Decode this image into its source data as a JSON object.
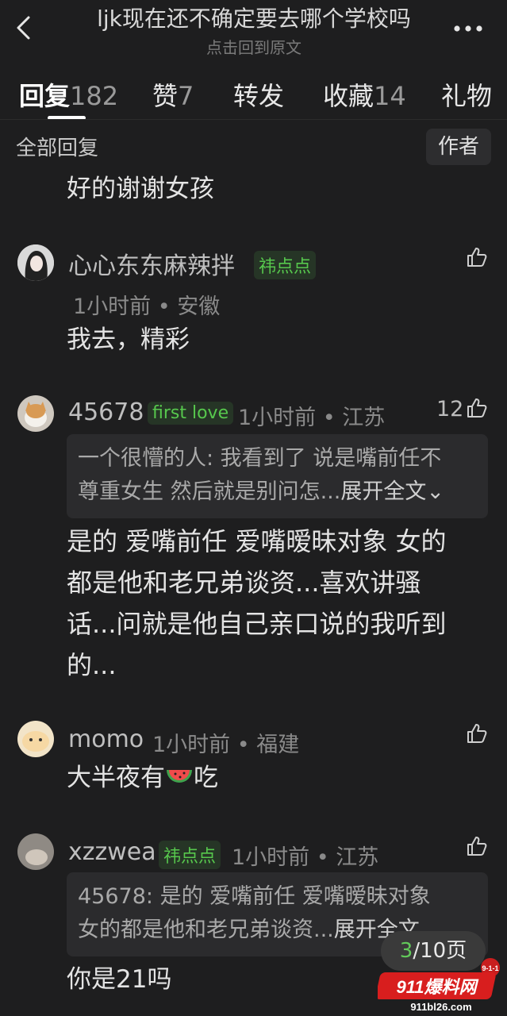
{
  "header": {
    "title": "ljk现在还不确定要去哪个学校吗",
    "subtitle": "点击回到原文"
  },
  "tabs": [
    {
      "label": "回复",
      "count": "182"
    },
    {
      "label": "赞",
      "count": "7"
    },
    {
      "label": "转发",
      "count": ""
    },
    {
      "label": "收藏",
      "count": "14"
    },
    {
      "label": "礼物",
      "count": ""
    }
  ],
  "filter": {
    "all_label": "全部回复",
    "author_label": "作者"
  },
  "top_text": "好的谢谢女孩",
  "comments": [
    {
      "username": "心心东东麻辣拌",
      "badge": "祎点点",
      "time": "1小时前",
      "location": "安徽",
      "text": "我去，精彩"
    },
    {
      "username": "45678",
      "badge": "first love",
      "time": "1小时前",
      "location": "江苏",
      "likes": "12",
      "quote_line1": "一个很懵的人: 我看到了 说是嘴前任不",
      "quote_line2": "尊重女生 然后就是别问怎...",
      "expand": "展开全文",
      "text_line1": "是的 爱嘴前任 爱嘴暧昧对象 女的",
      "text_line2": "都是他和老兄弟谈资...喜欢讲骚",
      "text_line3": "话...问就是他自己亲口说的我听到",
      "text_line4": "的..."
    },
    {
      "username": "momo",
      "time": "1小时前",
      "location": "福建",
      "text_before": "大半夜有",
      "text_after": "吃"
    },
    {
      "username": "xzzwea",
      "badge": "祎点点",
      "time": "1小时前",
      "location": "江苏",
      "quote_line1": "45678: 是的 爱嘴前任 爱嘴暧昧对象",
      "quote_line2": "女的都是他和老兄弟谈资...",
      "expand": "展开全文",
      "text": "你是21吗"
    }
  ],
  "pager": {
    "current": "3",
    "total": "/10页"
  },
  "watermark": {
    "brand": "911爆料网",
    "url": "911bl26.com",
    "tag": "9-1-1"
  }
}
